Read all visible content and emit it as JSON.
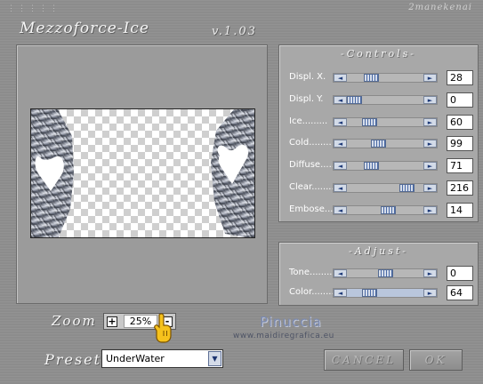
{
  "header": {
    "brand": "2manekenai",
    "title": "Mezzoforce-Ice",
    "version": "v.1.03"
  },
  "controls": {
    "title": "-Controls-",
    "sliders": [
      {
        "label": "Displ. X.",
        "value": "28",
        "level": 0.28
      },
      {
        "label": "Displ. Y.",
        "value": "0",
        "level": 0.0
      },
      {
        "label": "Ice.........",
        "value": "60",
        "level": 0.24
      },
      {
        "label": "Cold........",
        "value": "99",
        "level": 0.39
      },
      {
        "label": "Diffuse.....",
        "value": "71",
        "level": 0.28
      },
      {
        "label": "Clear........",
        "value": "216",
        "level": 0.85
      },
      {
        "label": "Embose......",
        "value": "14",
        "level": 0.55
      }
    ]
  },
  "adjust": {
    "title": "-Adjust-",
    "sliders": [
      {
        "label": "Tone.........",
        "value": "0",
        "level": 0.5
      },
      {
        "label": "Color........",
        "value": "64",
        "level": 0.25
      }
    ]
  },
  "zoom": {
    "label": "Zoom",
    "value": "25%",
    "plus": "+",
    "minus": "-"
  },
  "preset": {
    "label": "Preset",
    "value": "UnderWater"
  },
  "watermark": {
    "name": "Pinuccia",
    "url": "www.maidiregrafica.eu"
  },
  "buttons": {
    "cancel": "CANCEL",
    "ok": "OK"
  },
  "colors": {
    "accent": "#4a6aa6",
    "panel": "#a8a8a8"
  }
}
